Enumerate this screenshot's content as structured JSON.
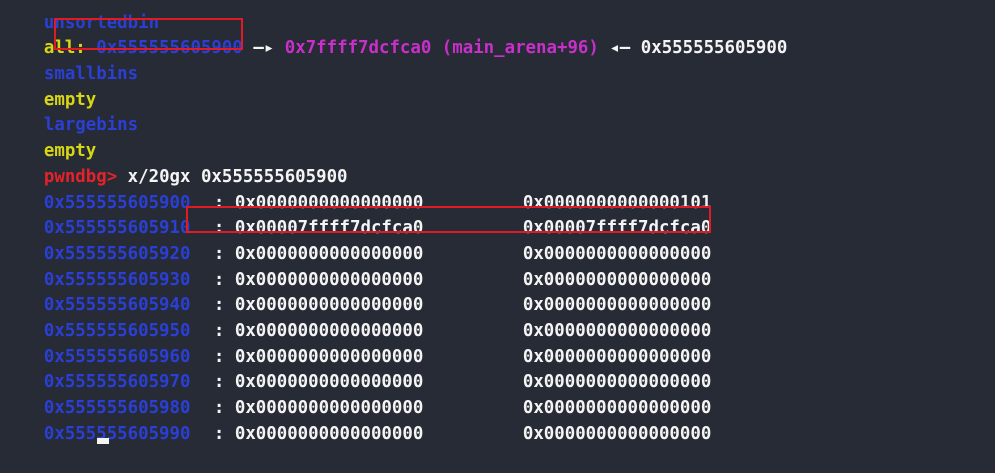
{
  "bins": {
    "unsorted_header": "unsortedbin",
    "all_label": "all:",
    "all_addr": "0x555555605900",
    "fd_arrow": " —▸ ",
    "fd_target": "0x7ffff7dcfca0 (main_arena+96)",
    "bk_arrow": " ◂— ",
    "bk_target": "0x555555605900",
    "smallbins_header": "smallbins",
    "smallbins_value": "empty",
    "largebins_header": "largebins",
    "largebins_value": "empty"
  },
  "prompt": {
    "label": "pwndbg>",
    "command": " x/20gx 0x555555605900"
  },
  "memory_rows": [
    {
      "addr": "0x555555605900",
      "q1": "0x0000000000000000",
      "q2": "0x0000000000000101"
    },
    {
      "addr": "0x555555605910",
      "q1": "0x00007ffff7dcfca0",
      "q2": "0x00007ffff7dcfca0"
    },
    {
      "addr": "0x555555605920",
      "q1": "0x0000000000000000",
      "q2": "0x0000000000000000"
    },
    {
      "addr": "0x555555605930",
      "q1": "0x0000000000000000",
      "q2": "0x0000000000000000"
    },
    {
      "addr": "0x555555605940",
      "q1": "0x0000000000000000",
      "q2": "0x0000000000000000"
    },
    {
      "addr": "0x555555605950",
      "q1": "0x0000000000000000",
      "q2": "0x0000000000000000"
    },
    {
      "addr": "0x555555605960",
      "q1": "0x0000000000000000",
      "q2": "0x0000000000000000"
    },
    {
      "addr": "0x555555605970",
      "q1": "0x0000000000000000",
      "q2": "0x0000000000000000"
    },
    {
      "addr": "0x555555605980",
      "q1": "0x0000000000000000",
      "q2": "0x0000000000000000"
    },
    {
      "addr": "0x555555605990",
      "q1": "0x0000000000000000",
      "q2": "0x0000000000000000"
    }
  ],
  "colors": {
    "background": "#262b36",
    "address_blue": "#2b3fd4",
    "label_yellow": "#d7d713",
    "symbol_magenta": "#c92fc9",
    "prompt_red": "#e4222a",
    "highlight_red": "#e01b24"
  }
}
